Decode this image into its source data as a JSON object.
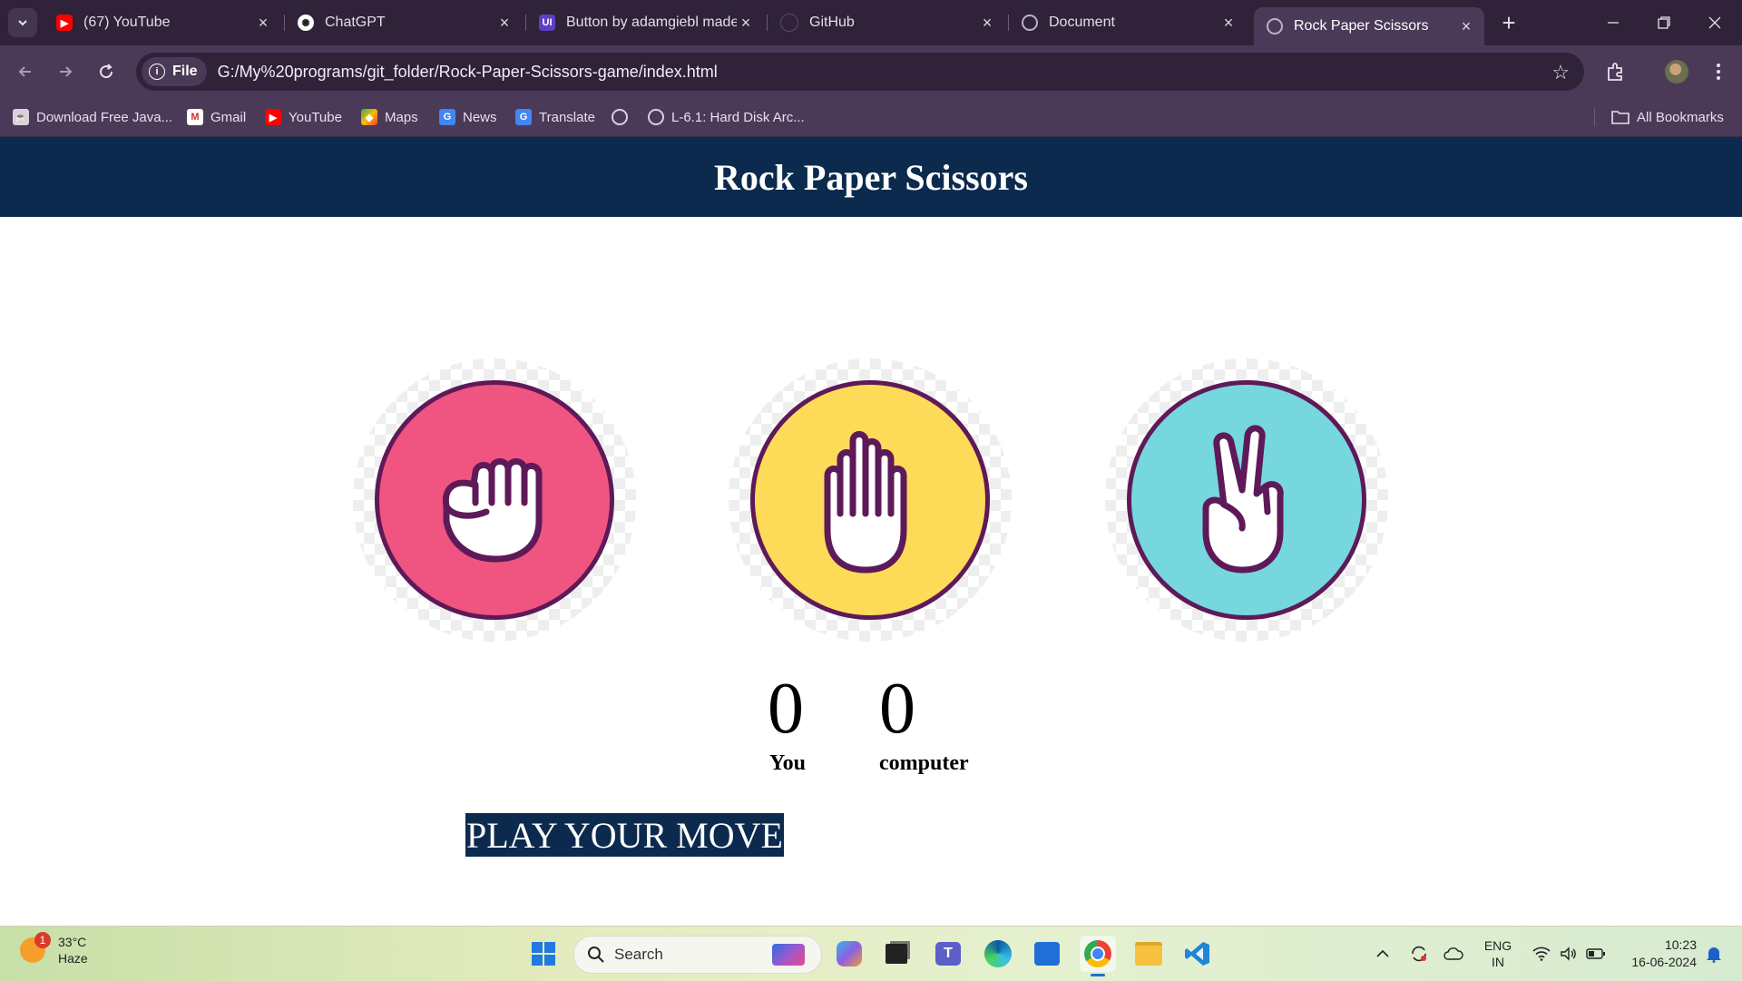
{
  "browser": {
    "tabs": [
      {
        "title": "(67) YouTube",
        "icon": "youtube-icon",
        "active": false
      },
      {
        "title": "ChatGPT",
        "icon": "chatgpt-icon",
        "active": false
      },
      {
        "title": "Button by adamgiebl made",
        "icon": "uiverse-icon",
        "active": false
      },
      {
        "title": "GitHub",
        "icon": "github-icon",
        "active": false
      },
      {
        "title": "Document",
        "icon": "globe-icon",
        "active": false
      },
      {
        "title": "Rock Paper Scissors",
        "icon": "globe-icon",
        "active": true
      }
    ],
    "address": {
      "scheme_label": "File",
      "url": "G:/My%20programs/git_folder/Rock-Paper-Scissors-game/index.html"
    },
    "bookmarks": [
      {
        "label": "Download Free Java...",
        "icon": "java-icon"
      },
      {
        "label": "Gmail",
        "icon": "gmail-icon"
      },
      {
        "label": "YouTube",
        "icon": "youtube-icon"
      },
      {
        "label": "Maps",
        "icon": "maps-icon"
      },
      {
        "label": "News",
        "icon": "news-icon"
      },
      {
        "label": "Translate",
        "icon": "translate-icon"
      },
      {
        "label": "",
        "icon": "globe-icon"
      },
      {
        "label": "L-6.1: Hard Disk Arc...",
        "icon": "globe-icon"
      }
    ],
    "all_bookmarks": "All Bookmarks"
  },
  "page": {
    "title": "Rock Paper Scissors",
    "choices": [
      {
        "id": "rock",
        "icon": "fist-icon",
        "color": "#ef5580"
      },
      {
        "id": "paper",
        "icon": "open-hand-icon",
        "color": "#fddb59"
      },
      {
        "id": "scissors",
        "icon": "peace-hand-icon",
        "color": "#76d7de"
      }
    ],
    "score": {
      "user_score": "0",
      "user_label": "You",
      "computer_score": "0",
      "computer_label": "computer"
    },
    "message": "PLAY YOUR MOVE",
    "colors": {
      "header_bg": "#0b2a4d",
      "outline": "#5e1a58"
    }
  },
  "taskbar": {
    "weather": {
      "temp": "33°C",
      "condition": "Haze",
      "badge": "1"
    },
    "search_placeholder": "Search",
    "language": {
      "line1": "ENG",
      "line2": "IN"
    },
    "clock": {
      "time": "10:23",
      "date": "16-06-2024"
    }
  }
}
